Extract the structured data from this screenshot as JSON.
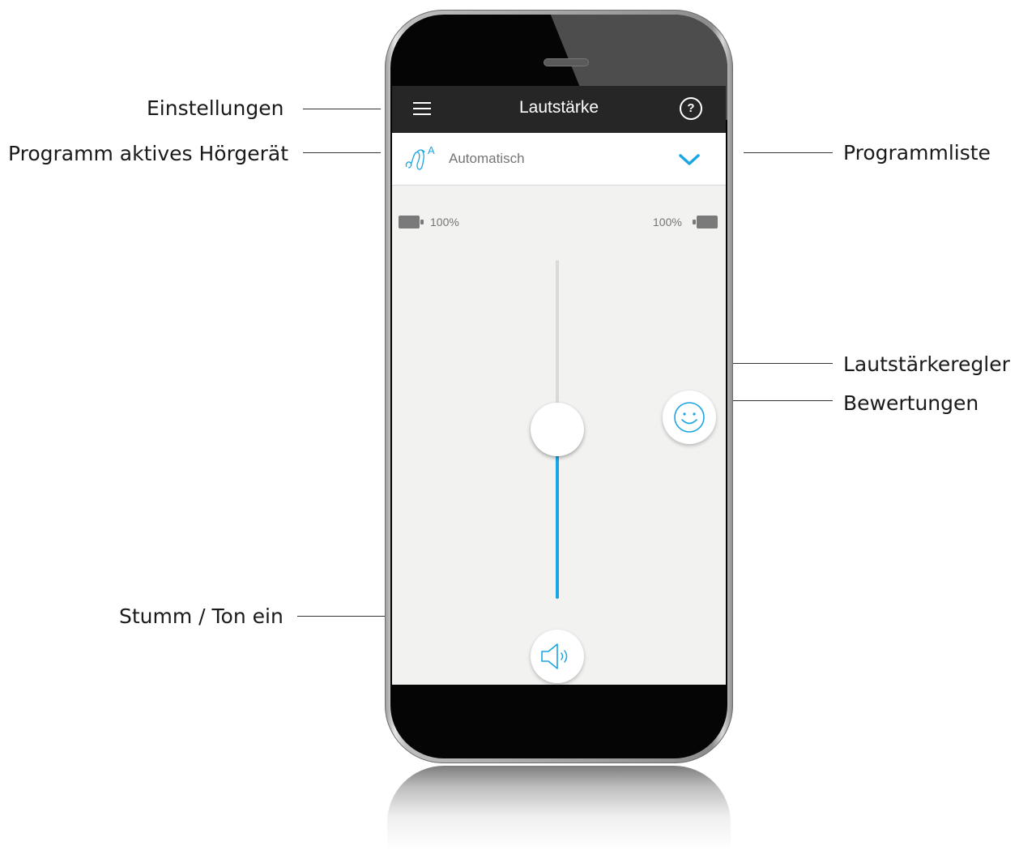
{
  "app": {
    "title": "Lautstärke",
    "help_label": "?"
  },
  "program": {
    "name": "Automatisch",
    "icon": "hearing-aid-automatic-icon"
  },
  "battery": {
    "left_label": "100%",
    "right_label": "100%"
  },
  "volume": {
    "level": 0.5
  },
  "callouts": {
    "settings": "Einstellungen",
    "active_program": "Programm aktives Hörgerät",
    "program_list": "Programmliste",
    "volume_control": "Lautstärkeregler",
    "ratings": "Bewertungen",
    "mute": "Stumm / Ton ein"
  },
  "colors": {
    "accent": "#1aa6e4",
    "topbar": "#262626",
    "screen_bg": "#f2f2f1"
  }
}
